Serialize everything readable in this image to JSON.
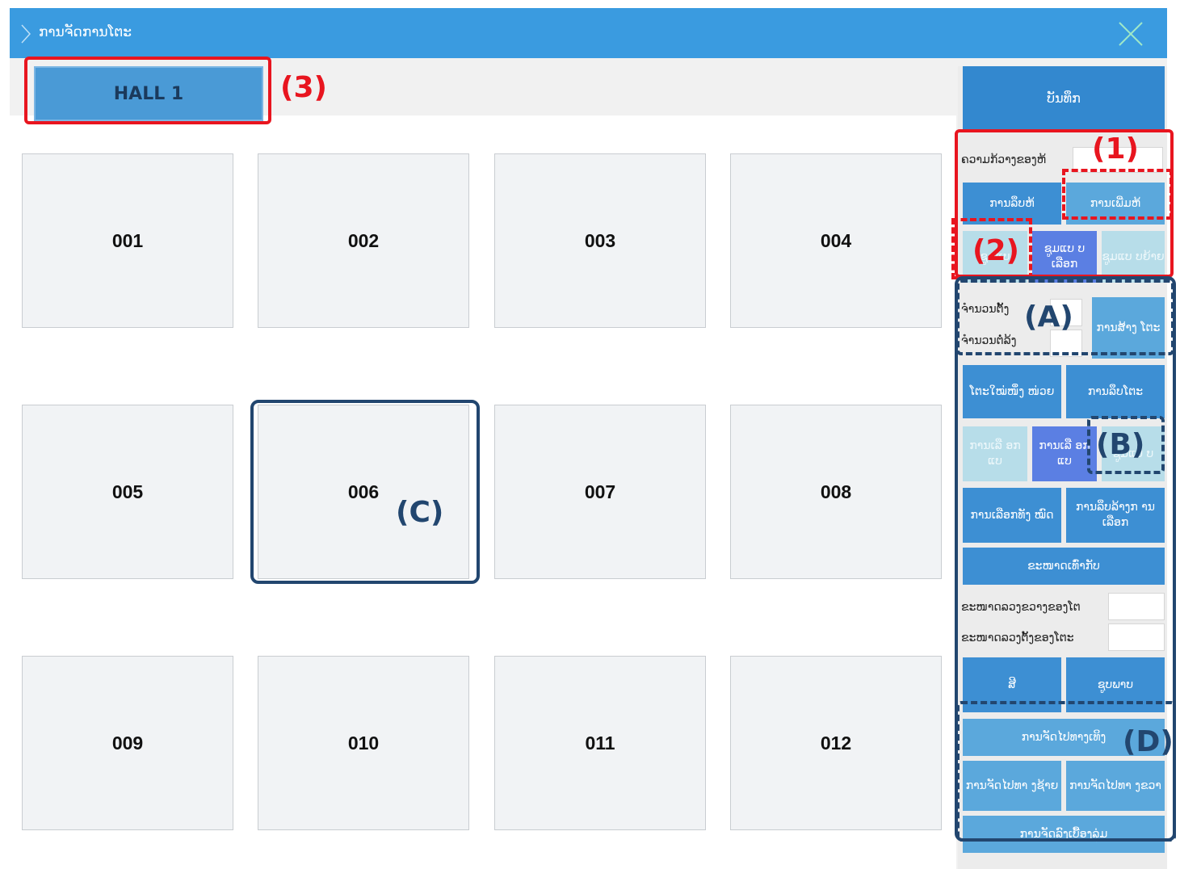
{
  "window": {
    "title": "ການຈັດການໂຕະ"
  },
  "hall": {
    "tab_label": "HALL 1"
  },
  "tables": [
    "001",
    "002",
    "003",
    "004",
    "005",
    "006",
    "007",
    "008",
    "009",
    "010",
    "011",
    "012"
  ],
  "panel": {
    "save_label": "ບັນທຶກ",
    "zone_name_label": "ຄວາມກ້ວາງຂອງຫ້",
    "delete_zone_label": "ການລຶບຫ້",
    "add_zone_label": "ການເພີ່ມຫ້",
    "zoom_in_label": "ຊູມແບ",
    "zoom_select_label": "ຊູມແບ ບເລືອກ",
    "zoom_move_label": "ຊູມແບ ບຍ້າຍ",
    "rows_label": "ຈຳນວນຕັ້ງ",
    "cols_label": "ຈຳນວນຕໍ່ລ້ງ",
    "create_tables_label": "ການສ້າງ ໂຕະ",
    "new_table_label": "ໂຕະໃໝ່ໜຶ່ງ ໜ່ວຍ",
    "delete_table_label": "ການລຶບໂຕະ",
    "select_mode1_label": "ການເລື ອກແບ",
    "select_mode2_label": "ການເລື ອກແບ",
    "select_mode3_label": "ຊູມແບ ບ",
    "select_all_label": "ການເລືອກທັງ ໝົດ",
    "clear_select_label": "ການລຶບລ້າງກ ານເລືອກ",
    "equal_size_label": "ຂະໜາດເທົ່າກັບ",
    "width_label": "ຂະໜາດລວງຂວາງຂອງໂຕ",
    "height_label": "ຂະໜາດລວງຕັ້ງຂອງໂຕະ",
    "color_label": "ສີ",
    "image_label": "ຊູບພາບ",
    "align_top_label": "ການຈັດໄປທາງເທິງ",
    "align_left_label": "ການຈັດໄປທາ ງຊ້າຍ",
    "align_right_label": "ການຈັດໄປທາ ງຂວາ",
    "align_center_label": "ການຈັດລົງເບື້ອງລຸ່ມ"
  },
  "annotations": {
    "one": "(1)",
    "two": "(2)",
    "three": "(3)",
    "a": "(A)",
    "b": "(B)",
    "c": "(C)",
    "d": "(D)"
  },
  "colors": {
    "titlebar": "#3a9be0",
    "button": "#3d8fd3",
    "selected": "#5b7fe3",
    "annotation_red": "#e8151f",
    "annotation_blue": "#22466f"
  }
}
